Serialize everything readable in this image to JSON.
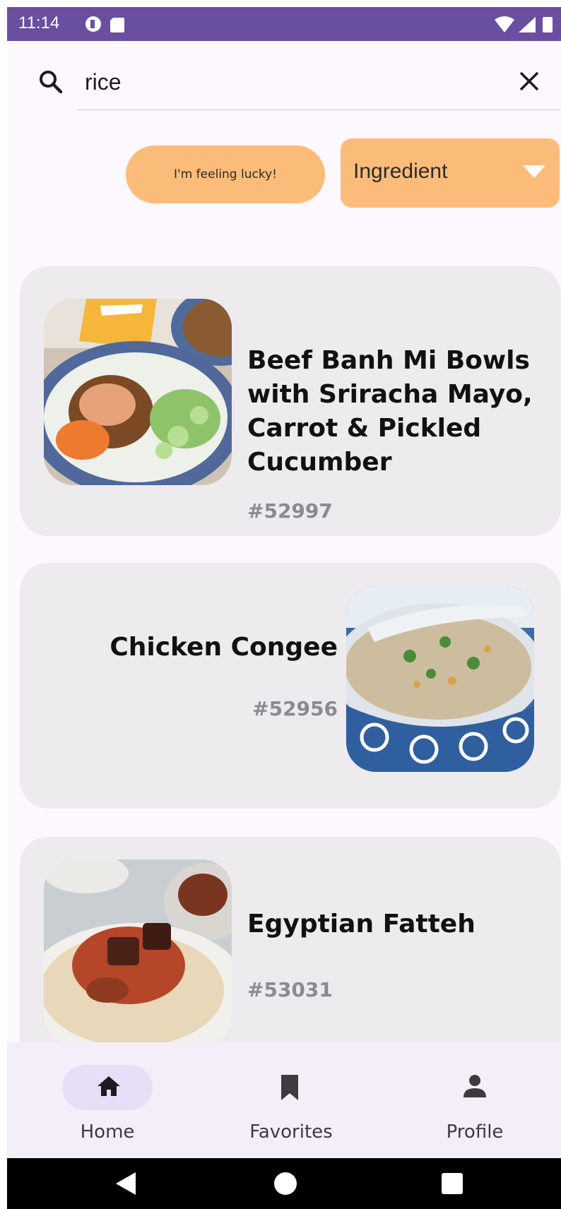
{
  "status_bar": {
    "time": "11:14"
  },
  "search": {
    "query": "rice"
  },
  "controls": {
    "lucky_label": "I'm feeling lucky!",
    "filter_value": "Ingredient"
  },
  "results": [
    {
      "title_lines": [
        "Beef Banh Mi Bowls",
        "with Sriracha Mayo,",
        "Carrot & Pickled",
        "Cucumber"
      ],
      "id": "#52997"
    },
    {
      "title_lines": [
        "Chicken Congee"
      ],
      "id": "#52956"
    },
    {
      "title_lines": [
        "Egyptian Fatteh"
      ],
      "id": "#53031"
    }
  ],
  "bottom_nav": [
    {
      "label": "Home",
      "icon": "home-icon",
      "selected": true
    },
    {
      "label": "Favorites",
      "icon": "bookmark-icon",
      "selected": false
    },
    {
      "label": "Profile",
      "icon": "person-icon",
      "selected": false
    }
  ],
  "system_nav": [
    "back-icon",
    "home-circle-icon",
    "recents-icon"
  ],
  "colors": {
    "status_bar": "#6a4fa0",
    "accent": "#fcbc79",
    "card": "#eeebef",
    "nav_pill": "#e8def8"
  }
}
